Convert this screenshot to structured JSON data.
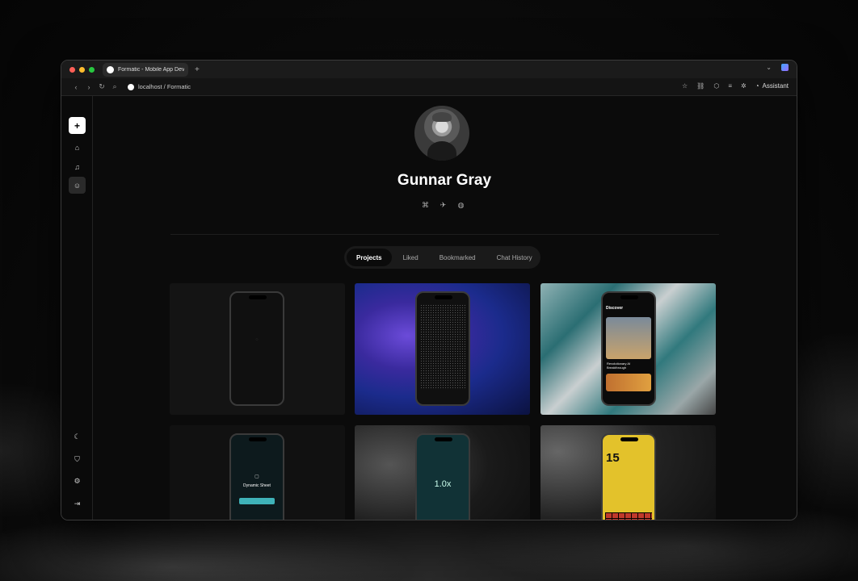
{
  "browser": {
    "tab_title": "Formatic - Mobile App Deve",
    "new_tab": "+",
    "url": "localhost / Formatic",
    "assistant_label": "Assistant"
  },
  "sidebar": {
    "new_label": "+"
  },
  "profile": {
    "name": "Gunnar Gray"
  },
  "tabs": [
    {
      "label": "Projects",
      "active": true
    },
    {
      "label": "Liked",
      "active": false
    },
    {
      "label": "Bookmarked",
      "active": false
    },
    {
      "label": "Chat History",
      "active": false
    }
  ],
  "cards": {
    "c3": {
      "title": "Discover",
      "headline": "Revolutionary AI Breakthrough"
    },
    "c4": {
      "title": "Dynamic Sheet"
    },
    "c5": {
      "value": "1.0x"
    },
    "c6": {
      "value": "15"
    }
  },
  "colors": {
    "accent_teal": "#3fb2b8",
    "calendar_yellow": "#e3c22b"
  }
}
